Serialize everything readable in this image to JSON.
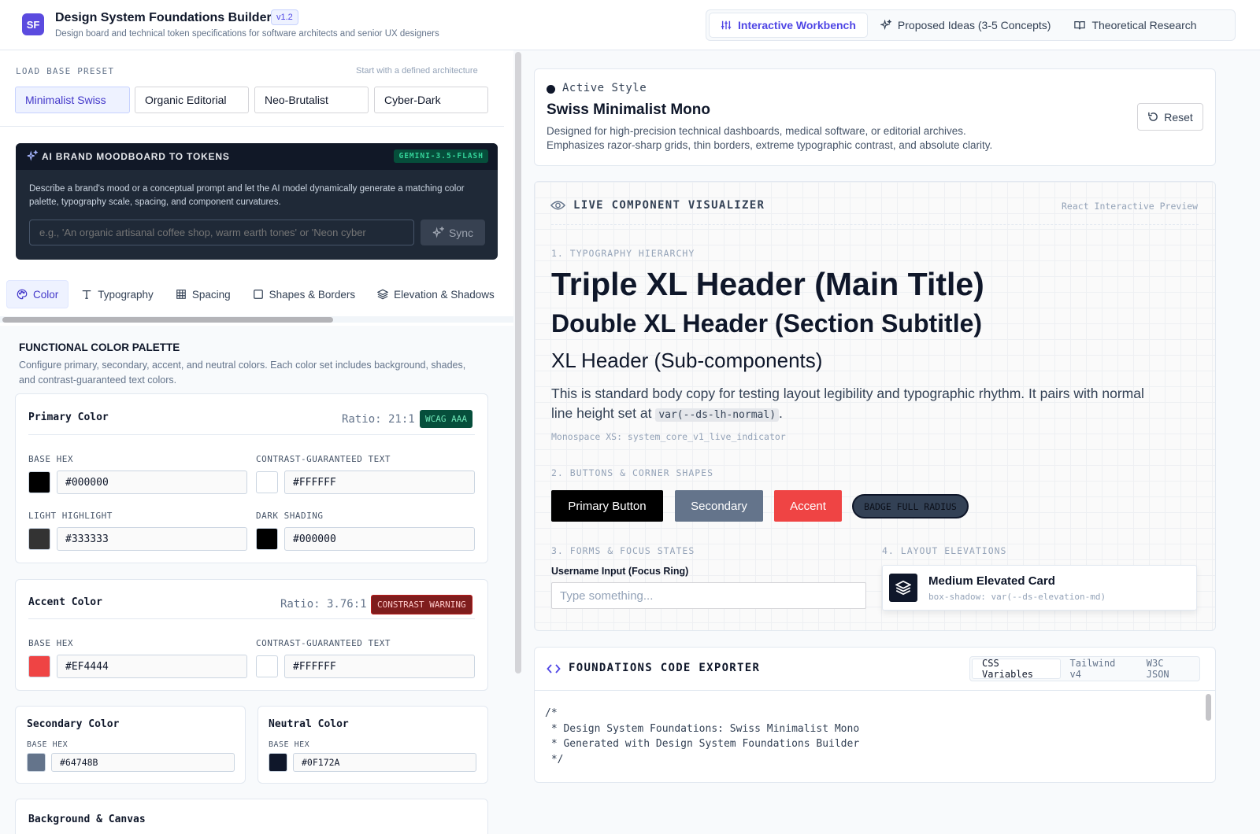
{
  "app": {
    "logo": "SF",
    "title": "Design System Foundations Builder",
    "version": "v1.2",
    "subtitle": "Design board and technical token specifications for software architects and senior UX designers"
  },
  "top_tabs": [
    {
      "label": "Interactive Workbench",
      "icon": "sliders-icon",
      "active": true
    },
    {
      "label": "Proposed Ideas (3-5 Concepts)",
      "icon": "sparkles-icon",
      "active": false
    },
    {
      "label": "Theoretical Research",
      "icon": "book-icon",
      "active": false
    }
  ],
  "presets": {
    "label": "LOAD BASE PRESET",
    "hint": "Start with a defined architecture",
    "items": [
      "Minimalist Swiss",
      "Organic Editorial",
      "Neo-Brutalist",
      "Cyber-Dark"
    ],
    "selected": "Minimalist Swiss"
  },
  "ai_moodboard": {
    "title": "AI BRAND MOODBOARD TO TOKENS",
    "model_badge": "GEMINI-3.5-FLASH",
    "description": "Describe a brand's mood or a conceptual prompt and let the AI model dynamically generate a matching color palette, typography scale, spacing, and component curvatures.",
    "placeholder": "e.g., 'An organic artisanal coffee shop, warm earth tones' or 'Neon cyber",
    "sync_label": "Sync"
  },
  "token_tabs": [
    {
      "label": "Color",
      "icon": "palette-icon",
      "active": true
    },
    {
      "label": "Typography",
      "icon": "type-icon",
      "active": false
    },
    {
      "label": "Spacing",
      "icon": "grid-icon",
      "active": false
    },
    {
      "label": "Shapes & Borders",
      "icon": "square-icon",
      "active": false
    },
    {
      "label": "Elevation & Shadows",
      "icon": "layers-icon",
      "active": false
    }
  ],
  "palette": {
    "title": "FUNCTIONAL COLOR PALETTE",
    "description": "Configure primary, secondary, accent, and neutral colors. Each color set includes background, shades, and contrast-guaranteed text colors.",
    "primary": {
      "title": "Primary Color",
      "ratio": "Ratio: 21:1",
      "badge": "WCAG AAA",
      "base_label": "BASE HEX",
      "base_hex": "#000000",
      "text_label": "CONTRAST-GUARANTEED TEXT",
      "text_hex": "#FFFFFF",
      "light_label": "LIGHT HIGHLIGHT",
      "light_hex": "#333333",
      "dark_label": "DARK SHADING",
      "dark_hex": "#000000"
    },
    "accent": {
      "title": "Accent Color",
      "ratio": "Ratio: 3.76:1",
      "badge": "CONSTRAST WARNING",
      "base_label": "BASE HEX",
      "base_hex": "#EF4444",
      "text_label": "CONTRAST-GUARANTEED TEXT",
      "text_hex": "#FFFFFF"
    },
    "secondary": {
      "title": "Secondary Color",
      "base_label": "BASE HEX",
      "base_hex": "#64748B"
    },
    "neutral": {
      "title": "Neutral Color",
      "base_label": "BASE HEX",
      "base_hex": "#0F172A"
    },
    "background": {
      "title": "Background & Canvas"
    }
  },
  "active_style": {
    "label": "Active Style",
    "name": "Swiss Minimalist Mono",
    "description_line1": "Designed for high-precision technical dashboards, medical software, or editorial archives.",
    "description_line2": "Emphasizes razor-sharp grids, thin borders, extreme typographic contrast, and absolute clarity.",
    "reset_label": "Reset"
  },
  "visualizer": {
    "title": "LIVE COMPONENT VISUALIZER",
    "hint": "React Interactive Preview",
    "typography_label": "1. TYPOGRAPHY HIERARCHY",
    "h3xl": "Triple XL Header (Main Title)",
    "h2xl": "Double XL Header (Section Subtitle)",
    "hxl": "XL Header (Sub-components)",
    "body_text": "This is standard body copy for testing layout legibility and typographic rhythm. It pairs with normal line height set at ",
    "body_code": "var(--ds-lh-normal)",
    "body_end": ".",
    "mono_xs": "Monospace XS: system_core_v1_live_indicator",
    "buttons_label": "2. BUTTONS & CORNER SHAPES",
    "primary_button": "Primary Button",
    "secondary_button": "Secondary",
    "accent_button": "Accent",
    "badge": "BADGE FULL RADIUS",
    "forms_label": "3. FORMS & FOCUS STATES",
    "input_label": "Username Input (Focus Ring)",
    "input_placeholder": "Type something...",
    "elevations_label": "4. LAYOUT ELEVATIONS",
    "elev_title": "Medium Elevated Card",
    "elev_sub": "box-shadow: var(--ds-elevation-md)"
  },
  "exporter": {
    "title": "FOUNDATIONS CODE EXPORTER",
    "formats": [
      "CSS Variables",
      "Tailwind v4",
      "W3C JSON"
    ],
    "selected": "CSS Variables",
    "code": "/*\n * Design System Foundations: Swiss Minimalist Mono\n * Generated with Design System Foundations Builder\n */"
  },
  "colors": {
    "brand": "#5b4bdf",
    "primary": "#000000",
    "secondary": "#64748B",
    "accent": "#EF4444",
    "neutral": "#0F172A"
  }
}
